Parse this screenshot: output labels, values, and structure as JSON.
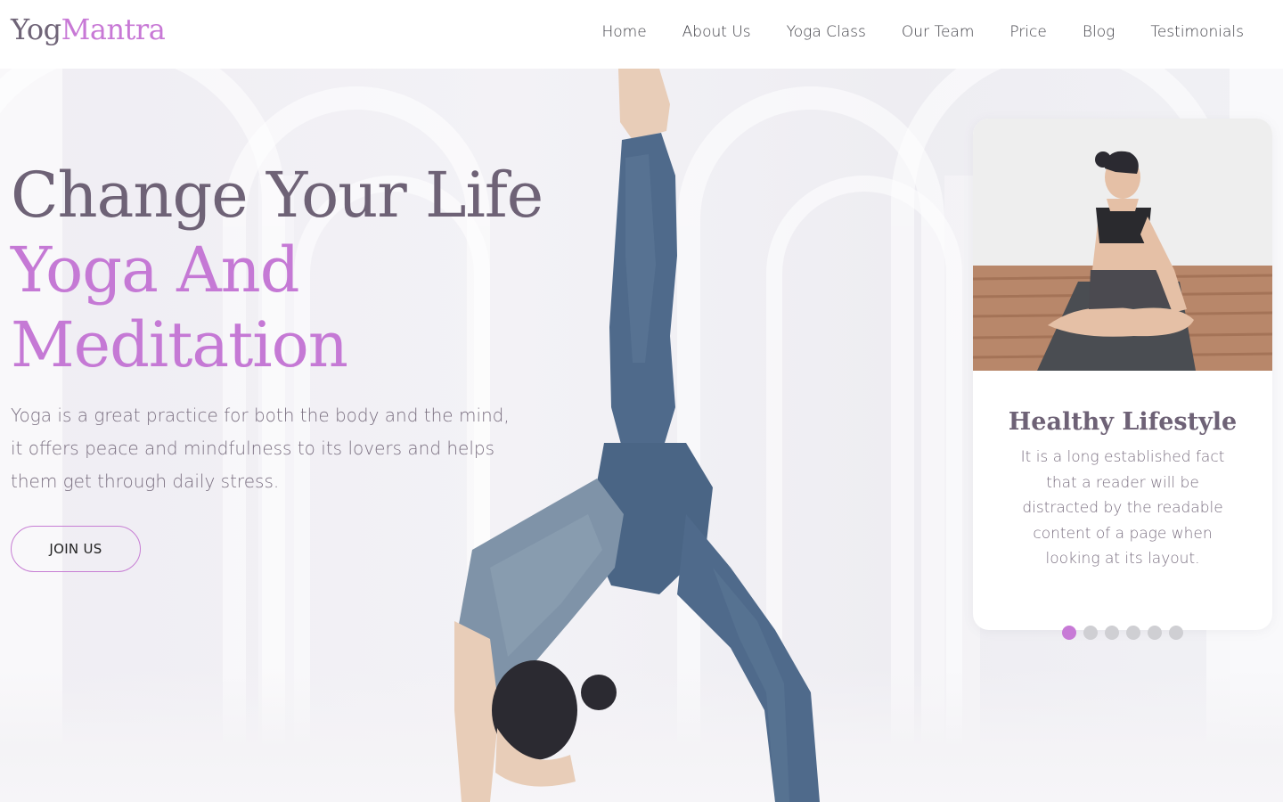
{
  "brand": {
    "logo_part1": "Yog",
    "logo_part2": "Mantra"
  },
  "nav": {
    "items": [
      "Home",
      "About Us",
      "Yoga Class",
      "Our Team",
      "Price",
      "Blog",
      "Testimonials"
    ]
  },
  "hero": {
    "headline_line1": "Change Your Life",
    "headline_line2": "Yoga And",
    "headline_line3": "Meditation",
    "description": "Yoga is a great practice for both the body and the mind, it offers peace and mindfulness to its lovers and helps them get through daily stress.",
    "cta_label": "JOIN US"
  },
  "card": {
    "title": "Healthy Lifestyle",
    "text": "It is a long established fact that a reader will be distracted by the readable content of a page when looking at its layout."
  },
  "carousel": {
    "total": 6,
    "active_index": 0
  },
  "colors": {
    "accent": "#c579d5",
    "heading": "#6e6276",
    "body_text": "#7a6f80",
    "dot_inactive": "#cfcfd3",
    "legging_blue": "#4f6a8b"
  },
  "icons": [
    "carousel-dot-icon"
  ]
}
